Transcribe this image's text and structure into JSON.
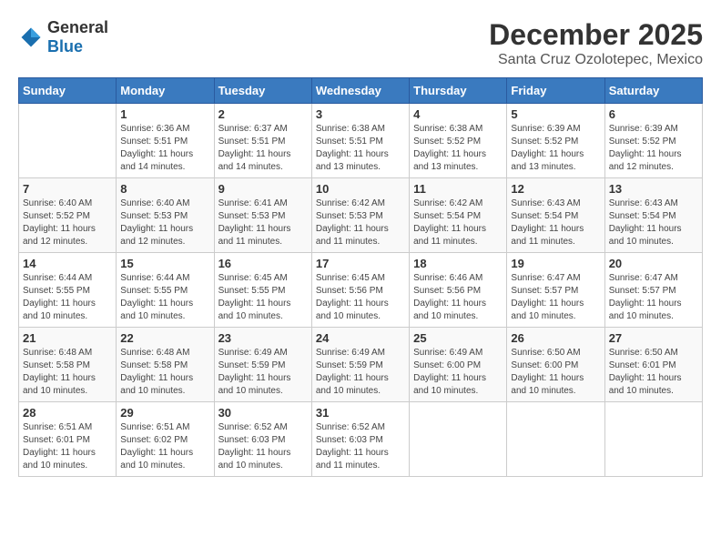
{
  "header": {
    "logo": {
      "general": "General",
      "blue": "Blue"
    },
    "title": "December 2025",
    "location": "Santa Cruz Ozolotepec, Mexico"
  },
  "weekdays": [
    "Sunday",
    "Monday",
    "Tuesday",
    "Wednesday",
    "Thursday",
    "Friday",
    "Saturday"
  ],
  "weeks": [
    [
      {
        "day": "",
        "info": ""
      },
      {
        "day": "1",
        "info": "Sunrise: 6:36 AM\nSunset: 5:51 PM\nDaylight: 11 hours and 14 minutes."
      },
      {
        "day": "2",
        "info": "Sunrise: 6:37 AM\nSunset: 5:51 PM\nDaylight: 11 hours and 14 minutes."
      },
      {
        "day": "3",
        "info": "Sunrise: 6:38 AM\nSunset: 5:51 PM\nDaylight: 11 hours and 13 minutes."
      },
      {
        "day": "4",
        "info": "Sunrise: 6:38 AM\nSunset: 5:52 PM\nDaylight: 11 hours and 13 minutes."
      },
      {
        "day": "5",
        "info": "Sunrise: 6:39 AM\nSunset: 5:52 PM\nDaylight: 11 hours and 13 minutes."
      },
      {
        "day": "6",
        "info": "Sunrise: 6:39 AM\nSunset: 5:52 PM\nDaylight: 11 hours and 12 minutes."
      }
    ],
    [
      {
        "day": "7",
        "info": "Sunrise: 6:40 AM\nSunset: 5:52 PM\nDaylight: 11 hours and 12 minutes."
      },
      {
        "day": "8",
        "info": "Sunrise: 6:40 AM\nSunset: 5:53 PM\nDaylight: 11 hours and 12 minutes."
      },
      {
        "day": "9",
        "info": "Sunrise: 6:41 AM\nSunset: 5:53 PM\nDaylight: 11 hours and 11 minutes."
      },
      {
        "day": "10",
        "info": "Sunrise: 6:42 AM\nSunset: 5:53 PM\nDaylight: 11 hours and 11 minutes."
      },
      {
        "day": "11",
        "info": "Sunrise: 6:42 AM\nSunset: 5:54 PM\nDaylight: 11 hours and 11 minutes."
      },
      {
        "day": "12",
        "info": "Sunrise: 6:43 AM\nSunset: 5:54 PM\nDaylight: 11 hours and 11 minutes."
      },
      {
        "day": "13",
        "info": "Sunrise: 6:43 AM\nSunset: 5:54 PM\nDaylight: 11 hours and 10 minutes."
      }
    ],
    [
      {
        "day": "14",
        "info": "Sunrise: 6:44 AM\nSunset: 5:55 PM\nDaylight: 11 hours and 10 minutes."
      },
      {
        "day": "15",
        "info": "Sunrise: 6:44 AM\nSunset: 5:55 PM\nDaylight: 11 hours and 10 minutes."
      },
      {
        "day": "16",
        "info": "Sunrise: 6:45 AM\nSunset: 5:55 PM\nDaylight: 11 hours and 10 minutes."
      },
      {
        "day": "17",
        "info": "Sunrise: 6:45 AM\nSunset: 5:56 PM\nDaylight: 11 hours and 10 minutes."
      },
      {
        "day": "18",
        "info": "Sunrise: 6:46 AM\nSunset: 5:56 PM\nDaylight: 11 hours and 10 minutes."
      },
      {
        "day": "19",
        "info": "Sunrise: 6:47 AM\nSunset: 5:57 PM\nDaylight: 11 hours and 10 minutes."
      },
      {
        "day": "20",
        "info": "Sunrise: 6:47 AM\nSunset: 5:57 PM\nDaylight: 11 hours and 10 minutes."
      }
    ],
    [
      {
        "day": "21",
        "info": "Sunrise: 6:48 AM\nSunset: 5:58 PM\nDaylight: 11 hours and 10 minutes."
      },
      {
        "day": "22",
        "info": "Sunrise: 6:48 AM\nSunset: 5:58 PM\nDaylight: 11 hours and 10 minutes."
      },
      {
        "day": "23",
        "info": "Sunrise: 6:49 AM\nSunset: 5:59 PM\nDaylight: 11 hours and 10 minutes."
      },
      {
        "day": "24",
        "info": "Sunrise: 6:49 AM\nSunset: 5:59 PM\nDaylight: 11 hours and 10 minutes."
      },
      {
        "day": "25",
        "info": "Sunrise: 6:49 AM\nSunset: 6:00 PM\nDaylight: 11 hours and 10 minutes."
      },
      {
        "day": "26",
        "info": "Sunrise: 6:50 AM\nSunset: 6:00 PM\nDaylight: 11 hours and 10 minutes."
      },
      {
        "day": "27",
        "info": "Sunrise: 6:50 AM\nSunset: 6:01 PM\nDaylight: 11 hours and 10 minutes."
      }
    ],
    [
      {
        "day": "28",
        "info": "Sunrise: 6:51 AM\nSunset: 6:01 PM\nDaylight: 11 hours and 10 minutes."
      },
      {
        "day": "29",
        "info": "Sunrise: 6:51 AM\nSunset: 6:02 PM\nDaylight: 11 hours and 10 minutes."
      },
      {
        "day": "30",
        "info": "Sunrise: 6:52 AM\nSunset: 6:03 PM\nDaylight: 11 hours and 10 minutes."
      },
      {
        "day": "31",
        "info": "Sunrise: 6:52 AM\nSunset: 6:03 PM\nDaylight: 11 hours and 11 minutes."
      },
      {
        "day": "",
        "info": ""
      },
      {
        "day": "",
        "info": ""
      },
      {
        "day": "",
        "info": ""
      }
    ]
  ]
}
